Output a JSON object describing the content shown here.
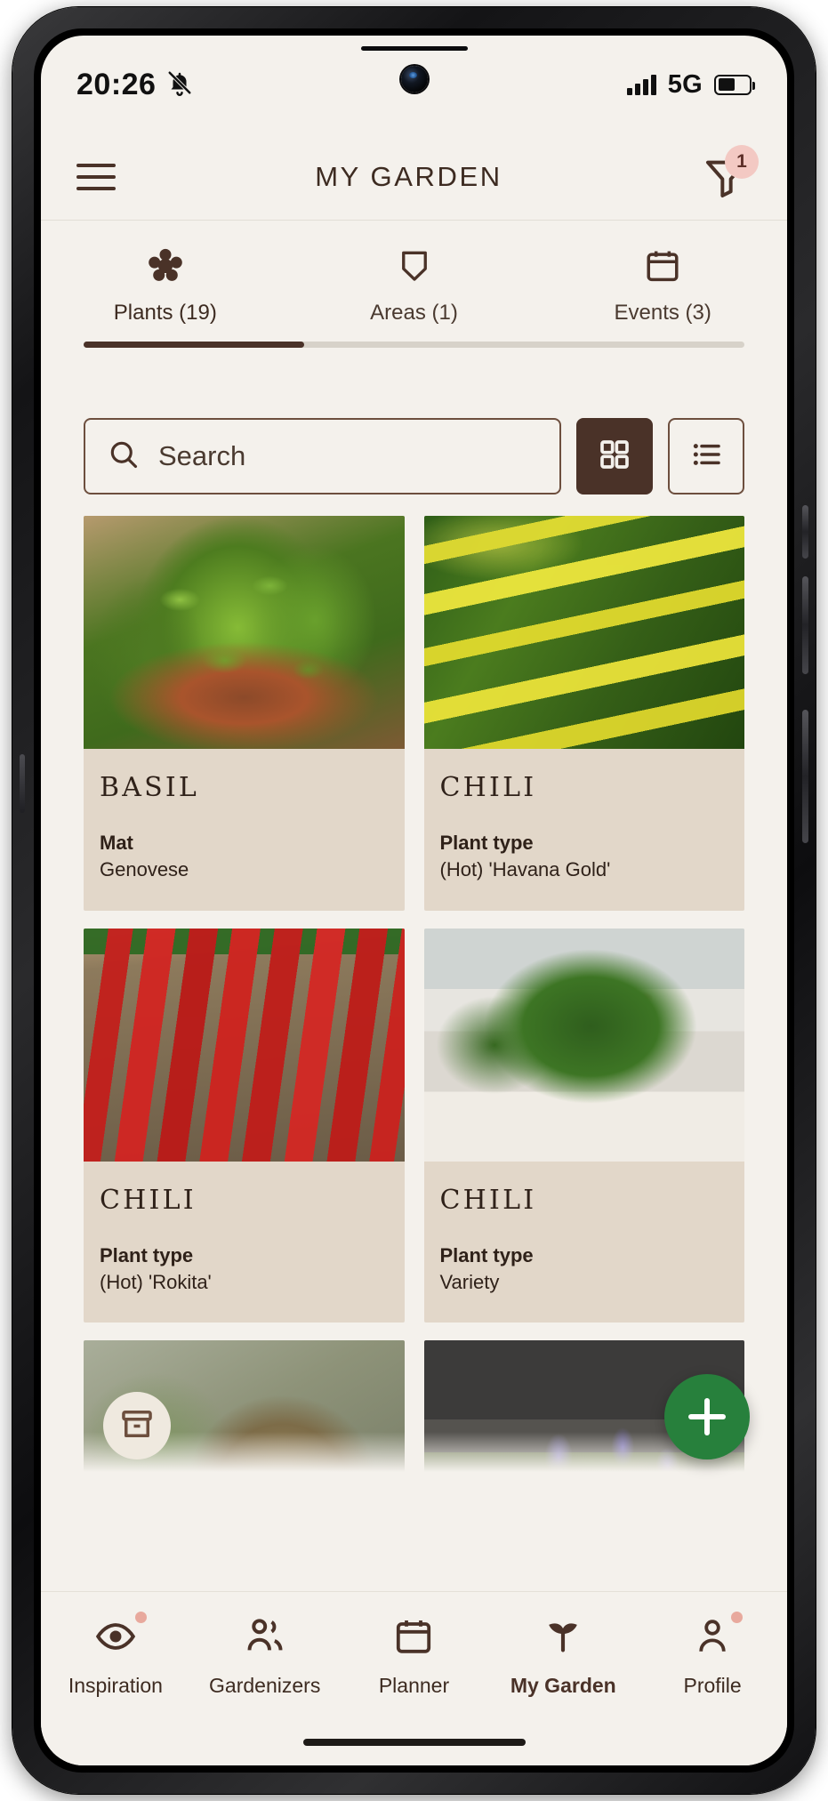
{
  "statusbar": {
    "time": "20:26",
    "mute_icon": "bell-muted-icon",
    "signal_icon": "signal-bars-icon",
    "network": "5G",
    "battery_icon": "battery-icon"
  },
  "appbar": {
    "menu_icon": "hamburger-menu-icon",
    "title": "MY GARDEN",
    "filter_icon": "filter-funnel-icon",
    "filter_badge": "1"
  },
  "tabs": [
    {
      "label": "Plants (19)",
      "icon": "flower-icon",
      "active": true
    },
    {
      "label": "Areas (1)",
      "icon": "shield-icon",
      "active": false
    },
    {
      "label": "Events (3)",
      "icon": "calendar-icon",
      "active": false
    }
  ],
  "search": {
    "placeholder": "Search",
    "value": "",
    "search_icon": "search-icon",
    "grid_view_icon": "grid-view-icon",
    "list_view_icon": "list-view-icon",
    "active_view": "grid"
  },
  "plants": [
    {
      "title": "BASIL",
      "line1": "Mat",
      "line2": "Genovese",
      "photo": "ph-basil",
      "archived": false
    },
    {
      "title": "CHILI",
      "line1": "Plant type",
      "line2": "(Hot) 'Havana Gold'",
      "photo": "ph-yellowchili",
      "archived": false
    },
    {
      "title": "CHILI",
      "line1": "Plant type",
      "line2": "(Hot) 'Rokita'",
      "photo": "ph-redchili",
      "archived": false
    },
    {
      "title": "CHILI",
      "line1": "Plant type",
      "line2": "Variety",
      "photo": "ph-potchili",
      "archived": false
    },
    {
      "title": "",
      "line1": "",
      "line2": "",
      "photo": "ph-dried",
      "archived": true
    },
    {
      "title": "",
      "line1": "",
      "line2": "",
      "photo": "ph-lavender",
      "archived": false
    }
  ],
  "fab": {
    "icon": "add-plus-icon",
    "label": "+"
  },
  "bottomnav": [
    {
      "label": "Inspiration",
      "icon": "eye-icon",
      "active": false,
      "dot": true
    },
    {
      "label": "Gardenizers",
      "icon": "people-icon",
      "active": false,
      "dot": false
    },
    {
      "label": "Planner",
      "icon": "calendar-icon",
      "active": false,
      "dot": false
    },
    {
      "label": "My Garden",
      "icon": "plant-icon",
      "active": true,
      "dot": false
    },
    {
      "label": "Profile",
      "icon": "person-icon",
      "active": false,
      "dot": true
    }
  ],
  "colors": {
    "brand_brown": "#4a3228",
    "screen_bg": "#f4f1ec",
    "card_bg": "#e2d7c9",
    "fab_green": "#27803c",
    "badge_pink": "#f3c9c3"
  }
}
